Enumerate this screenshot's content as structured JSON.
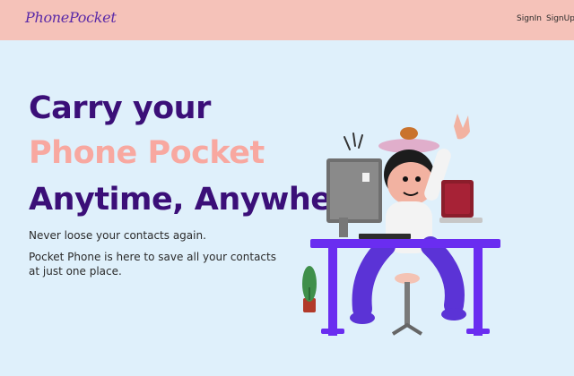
{
  "navbar": {
    "logo": "PhonePocket",
    "links": [
      "SignIn",
      "SignUp"
    ]
  },
  "hero": {
    "heading_line1": "Carry your",
    "heading_line2": "Phone Pocket",
    "heading_line3": "Anytime, Anywhere",
    "desc1": "Never loose your contacts again.",
    "desc2": "Pocket Phone is here to save all your contacts at just one place."
  },
  "colors": {
    "navbar_bg": "#f5c2b9",
    "page_bg": "#dff0fb",
    "heading_primary": "#3b0f78",
    "heading_accent": "#f8a8a0",
    "desk": "#6a2df0"
  }
}
